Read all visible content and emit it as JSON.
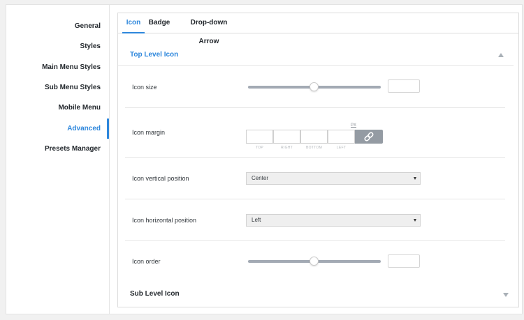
{
  "sidebar": {
    "items": [
      {
        "label": "General"
      },
      {
        "label": "Styles"
      },
      {
        "label": "Main Menu Styles"
      },
      {
        "label": "Sub Menu Styles"
      },
      {
        "label": "Mobile Menu"
      },
      {
        "label": "Advanced",
        "active": true
      },
      {
        "label": "Presets Manager"
      }
    ]
  },
  "tabs": [
    {
      "label": "Icon",
      "active": true
    },
    {
      "label": "Badge"
    },
    {
      "label": "Drop-down Arrow"
    }
  ],
  "sections": {
    "top": {
      "title": "Top Level Icon",
      "state": "expanded"
    },
    "sub": {
      "title": "Sub Level Icon",
      "state": "collapsed"
    }
  },
  "fields": {
    "icon_size": {
      "label": "Icon size",
      "slider_level": 0.5,
      "value": ""
    },
    "icon_margin": {
      "label": "Icon margin",
      "unit": "PX",
      "sides": [
        "TOP",
        "RIGHT",
        "BOTTOM",
        "LEFT"
      ],
      "values": [
        "",
        "",
        "",
        ""
      ],
      "link_icon": "link-icon"
    },
    "icon_vertical_position": {
      "label": "Icon vertical position",
      "selected": "Center"
    },
    "icon_horizontal_position": {
      "label": "Icon horizontal position",
      "selected": "Left"
    },
    "icon_order": {
      "label": "Icon order",
      "slider_level": 0.5,
      "value": ""
    }
  },
  "colors": {
    "accent": "#2e87dc",
    "link_button": "#949ba3",
    "slider_track": "#a3aab4"
  }
}
